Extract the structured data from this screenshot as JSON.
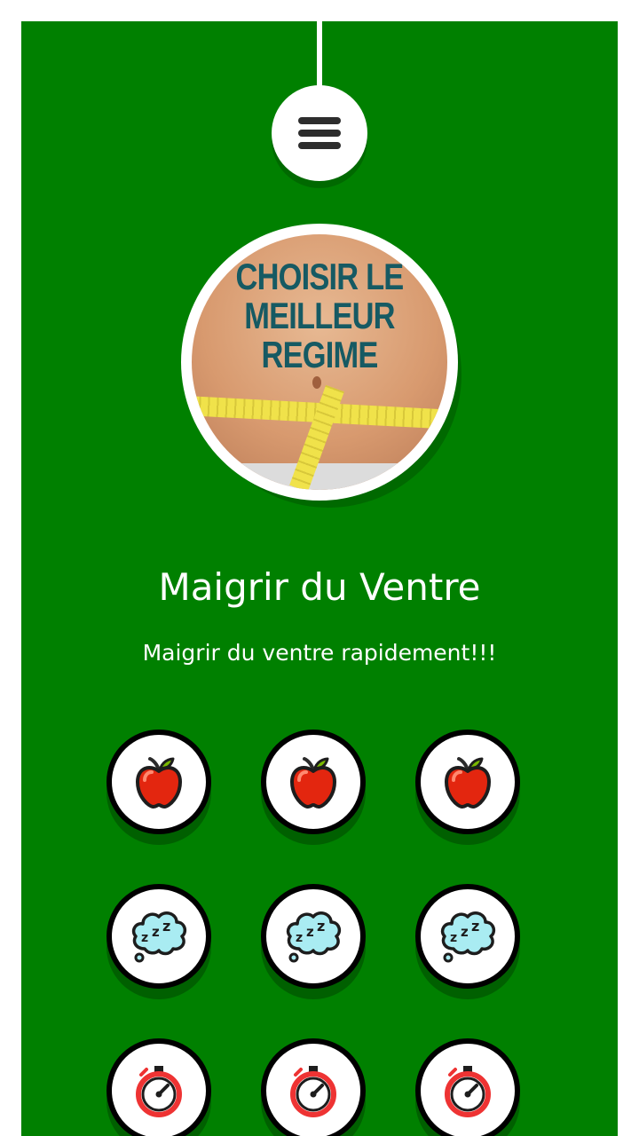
{
  "header": {
    "menu_icon": "hamburger-icon"
  },
  "hero": {
    "image_text_lines": [
      "CHOISIR LE",
      "MEILLEUR",
      "REGIME"
    ]
  },
  "main": {
    "title": "Maigrir du Ventre",
    "subtitle": "Maigrir du ventre rapidement!!!"
  },
  "grid": {
    "rows": [
      {
        "icon": "apple-icon"
      },
      {
        "icon": "sleep-cloud-icon"
      },
      {
        "icon": "stopwatch-icon"
      }
    ]
  },
  "colors": {
    "background": "#008000",
    "page": "#ffffff",
    "text": "#ffffff",
    "button_border": "#000000"
  }
}
